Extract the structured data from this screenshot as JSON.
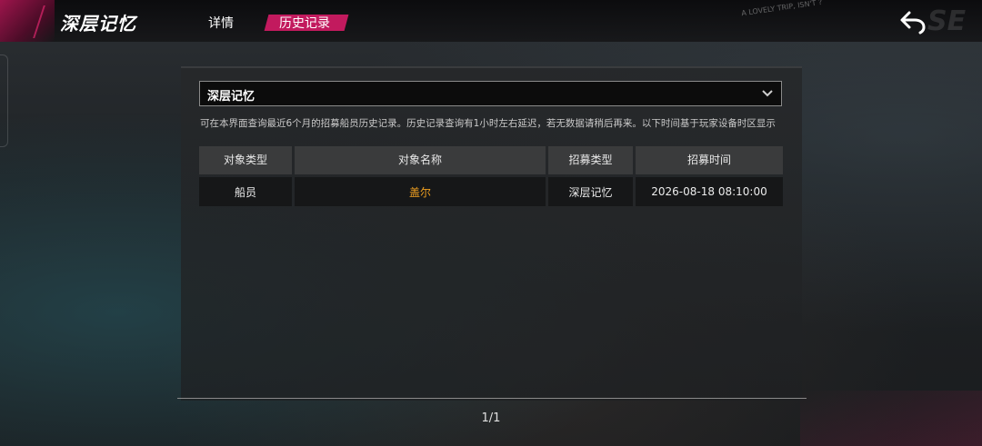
{
  "header": {
    "title": "深层记忆",
    "tabs": [
      {
        "label": "详情",
        "active": false
      },
      {
        "label": "历史记录",
        "active": true
      }
    ],
    "back_icon": "back-arrow-icon",
    "bg_text_small": "A LOVELY TRIP, ISN'T ?",
    "bg_text_large": "SE"
  },
  "filter": {
    "selected": "深层记忆",
    "icon": "chevron-down-icon"
  },
  "notice": "可在本界面查询最近6个月的招募船员历史记录。历史记录查询有1小时左右延迟，若无数据请稍后再来。以下时间基于玩家设备时区显示",
  "table": {
    "columns": [
      "对象类型",
      "对象名称",
      "招募类型",
      "招募时间"
    ],
    "rows": [
      [
        "船员",
        "盖尔",
        "深层记忆",
        "2026-08-18 08:10:00"
      ]
    ]
  },
  "pager": "1/1",
  "colors": {
    "accent": "#c21a5e",
    "highlight_name": "#f0a020"
  }
}
